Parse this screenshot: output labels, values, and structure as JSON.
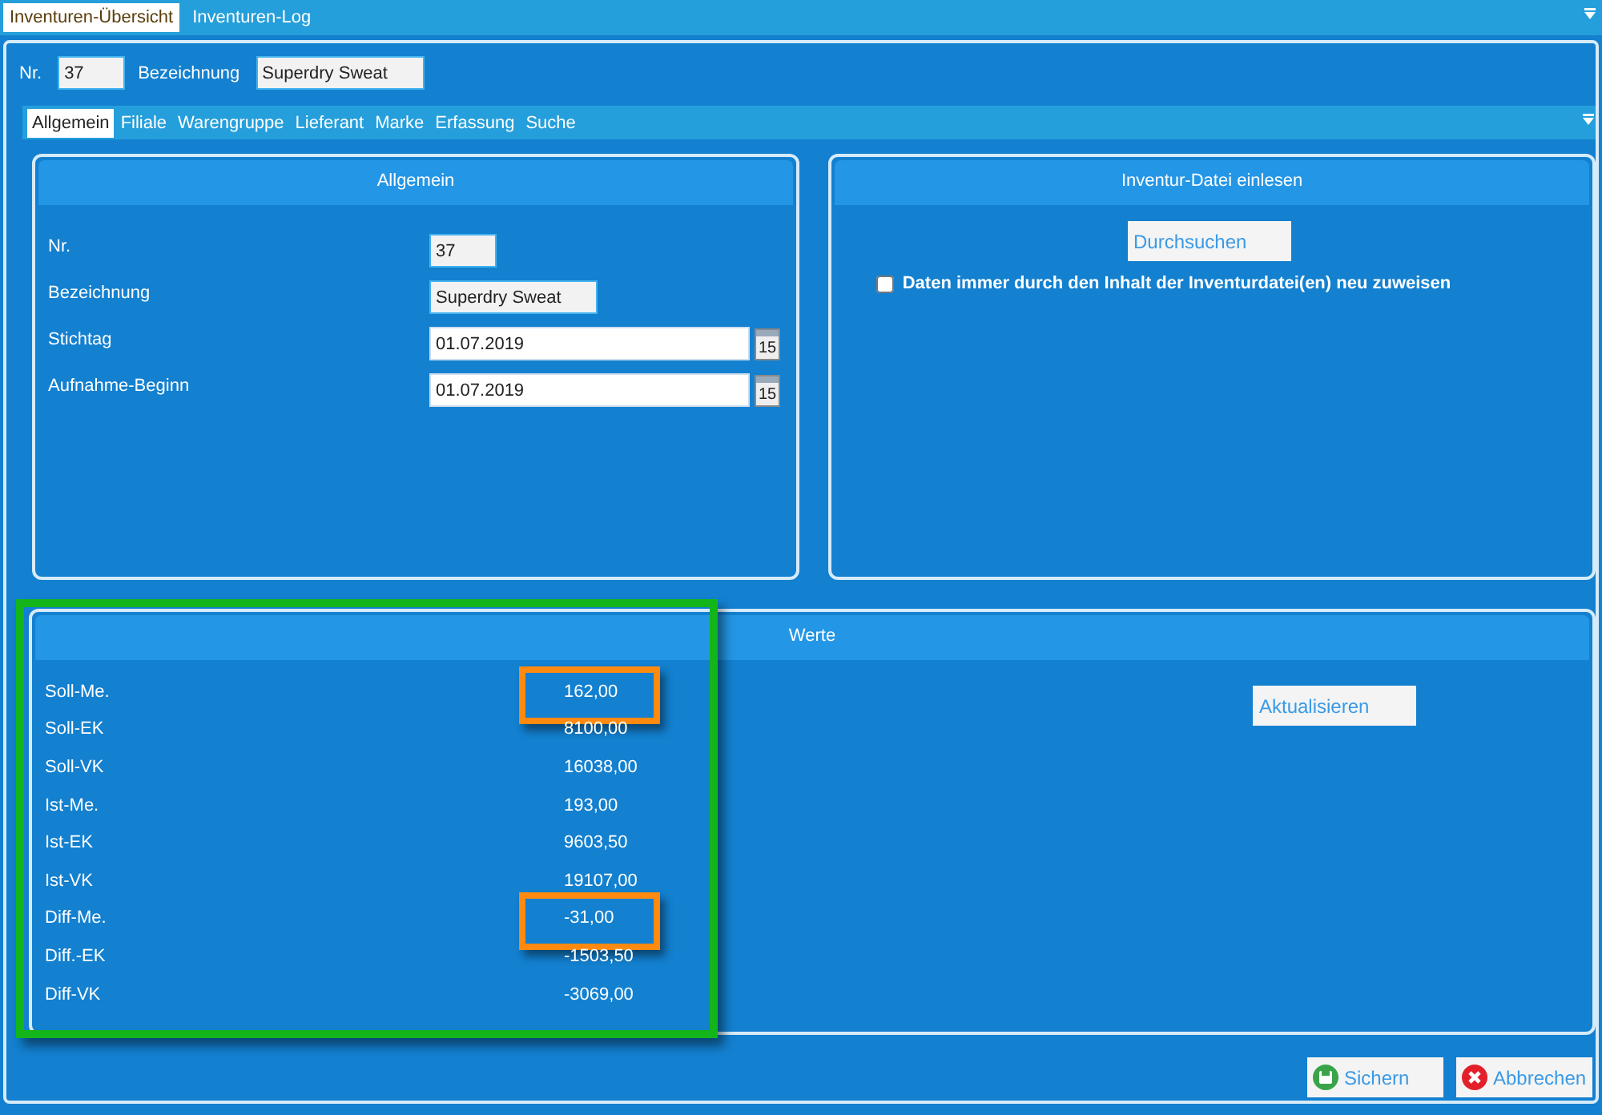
{
  "tabs": [
    {
      "label": "Inventuren-Übersicht",
      "selected": true
    },
    {
      "label": "Inventuren-Log",
      "selected": false
    }
  ],
  "header": {
    "fields": [
      {
        "label": "Nr.",
        "value": "37",
        "kind": "short"
      },
      {
        "label": "Bezeichnung",
        "value": "Superdry Sweat",
        "kind": "text"
      }
    ]
  },
  "subtabs": [
    {
      "label": "Allgemein",
      "selected": true
    },
    {
      "label": "Filiale",
      "selected": false
    },
    {
      "label": "Warengruppe",
      "selected": false
    },
    {
      "label": "Lieferant",
      "selected": false
    },
    {
      "label": "Marke",
      "selected": false
    },
    {
      "label": "Erfassung",
      "selected": false
    },
    {
      "label": "Suche",
      "selected": false
    }
  ],
  "general_panel": {
    "title": "Allgemein",
    "fields": [
      {
        "label": "Nr.",
        "value": "37",
        "kind": "short"
      },
      {
        "label": "Bezeichnung",
        "value": "Superdry Sweat",
        "kind": "text"
      },
      {
        "label": "Stichtag",
        "value": "01.07.2019",
        "kind": "date",
        "calendar_label": "15"
      },
      {
        "label": "Aufnahme-Beginn",
        "value": "01.07.2019",
        "kind": "date",
        "calendar_label": "15"
      }
    ]
  },
  "import_panel": {
    "title": "Inventur-Datei einlesen",
    "browse_button": "Durchsuchen",
    "checkbox": {
      "label": "Daten immer durch den Inhalt der Inventurdatei(en) neu zuweisen",
      "checked": false
    }
  },
  "values_panel": {
    "title": "Werte",
    "refresh_button": "Aktualisieren",
    "rows": [
      {
        "label": "Soll-Me.",
        "value": "162,00",
        "highlighted": true
      },
      {
        "label": "Soll-EK",
        "value": "8100,00",
        "highlighted": false
      },
      {
        "label": "Soll-VK",
        "value": "16038,00",
        "highlighted": false
      },
      {
        "label": "Ist-Me.",
        "value": "193,00",
        "highlighted": false
      },
      {
        "label": "Ist-EK",
        "value": "9603,50",
        "highlighted": false
      },
      {
        "label": "Ist-VK",
        "value": "19107,00",
        "highlighted": false
      },
      {
        "label": "Diff-Me.",
        "value": "-31,00",
        "highlighted": true
      },
      {
        "label": "Diff.-EK",
        "value": "-1503,50",
        "highlighted": false
      },
      {
        "label": "Diff-VK",
        "value": "-3069,00",
        "highlighted": false
      }
    ]
  },
  "buttons": [
    {
      "label": "Sichern",
      "kind": "save"
    },
    {
      "label": "Abbrechen",
      "kind": "cancel"
    }
  ]
}
